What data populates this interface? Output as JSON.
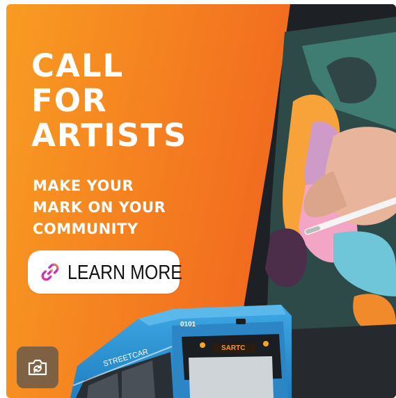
{
  "headline": [
    "CALL",
    "FOR",
    "ARTISTS"
  ],
  "subheadline": [
    "MAKE YOUR",
    "MARK ON YOUR",
    "COMMUNITY"
  ],
  "cta": {
    "label": "LEARN MORE",
    "icon": "link-icon"
  },
  "streetcar": {
    "number": "0101",
    "destination": "SARTC",
    "brand": "STREETCAR"
  },
  "actions": {
    "camera_icon": "camera-rotate-icon"
  },
  "colors": {
    "orange_light": "#f79a21",
    "orange_dark": "#f05a1e",
    "streetcar_blue": "#2d97d8",
    "text": "#ffffff"
  }
}
